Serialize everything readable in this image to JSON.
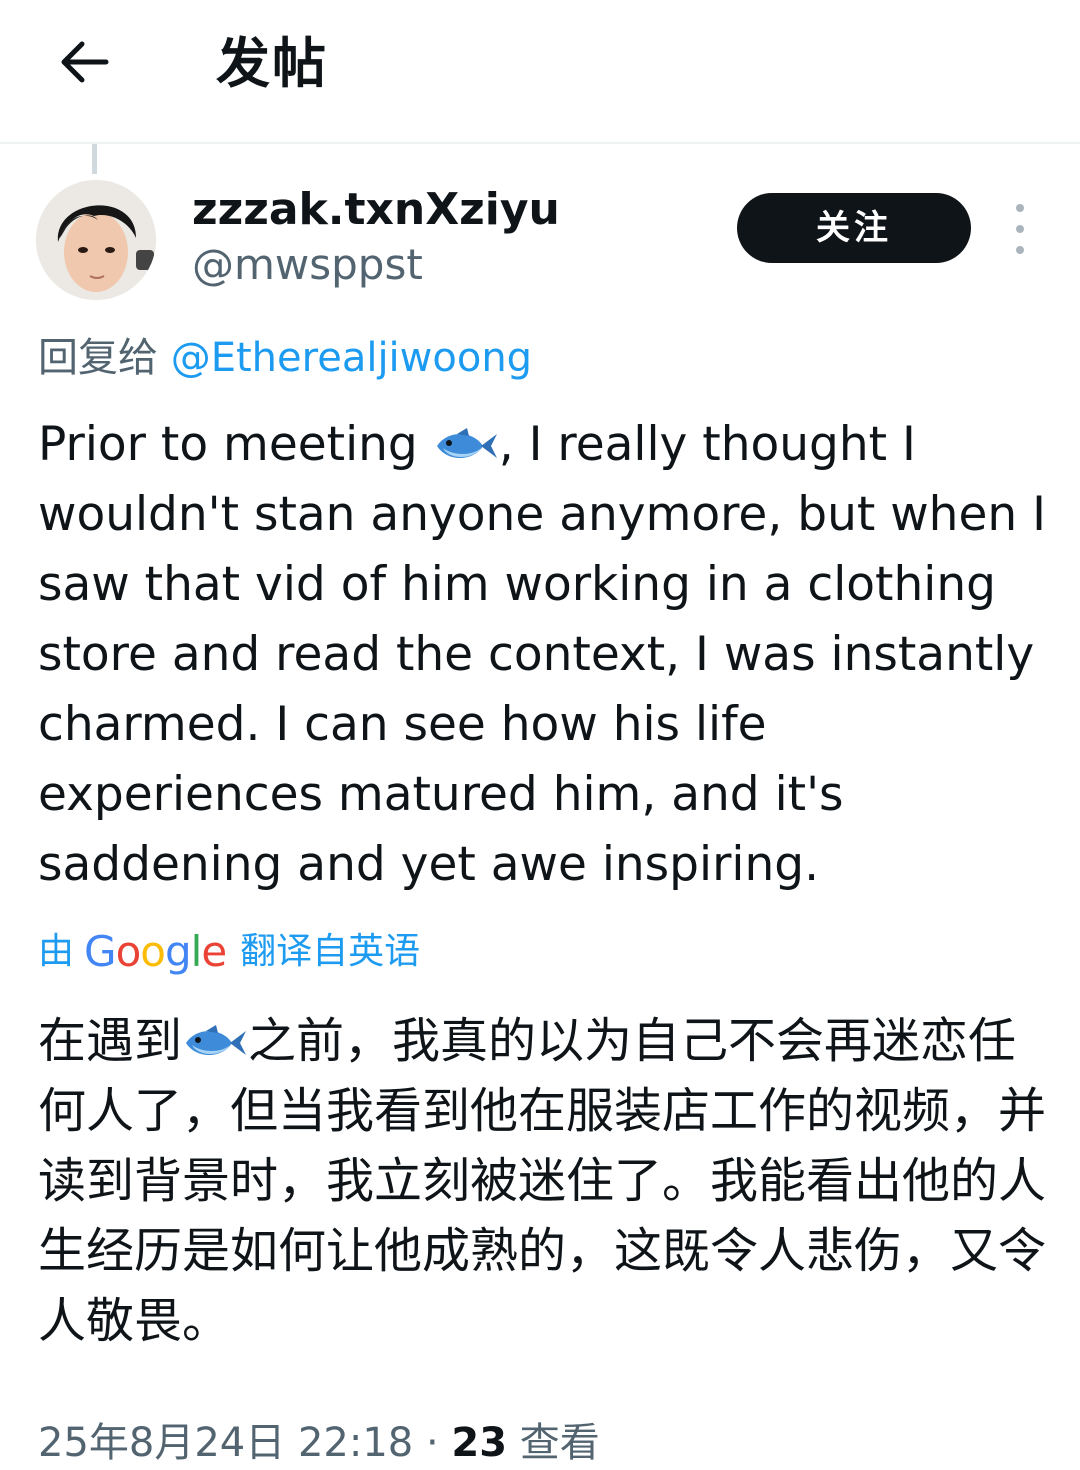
{
  "header": {
    "back_icon": "arrow-left-icon",
    "title": "发帖"
  },
  "author": {
    "display_name": "zzzak.txnXziyu",
    "handle": "@mwsppst",
    "avatar_icon": "user-avatar-photo",
    "follow_label": "关注",
    "more_icon": "more-vertical-icon"
  },
  "reply": {
    "prefix": "回复给 ",
    "mention": "@Etherealjiwoong"
  },
  "tweet": {
    "text_before_emoji": "Prior to meeting ",
    "emoji_icon": "fish-emoji-icon",
    "text_after_emoji": ", I really thought I wouldn't stan anyone anymore, but when I saw that vid of him working in a clothing store and read the context, I was instantly charmed. I can see how his life experiences matured him, and it's saddening and yet awe inspiring."
  },
  "translation": {
    "by_prefix": "由",
    "google_logo_text": "Google",
    "by_suffix": "翻译自英语",
    "text_before_emoji": "在遇到",
    "text_after_emoji": "之前，我真的以为自己不会再迷恋任何人了，但当我看到他在服装店工作的视频，并读到背景时，我立刻被迷住了。我能看出他的人生经历是如何让他成熟的，这既令人悲伤，又令人敬畏。"
  },
  "meta": {
    "datetime": "25年8月24日 22:18 · ",
    "views_count": "23",
    "views_label": " 查看"
  },
  "colors": {
    "accent_blue": "#1d9bf0",
    "secondary_text": "#536471",
    "button_bg": "#0f1419"
  }
}
